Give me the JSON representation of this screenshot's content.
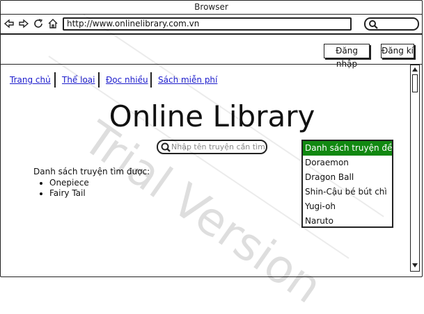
{
  "window": {
    "title": "Browser"
  },
  "browser": {
    "url": "http://www.onlinelibrary.com.vn",
    "search_placeholder": ""
  },
  "header": {
    "login_label": "Đăng nhập",
    "register_label": "Đăng kí"
  },
  "nav": {
    "items": [
      {
        "label": "Trang chủ"
      },
      {
        "label": "Thể loại"
      },
      {
        "label": "Đọc nhiều"
      },
      {
        "label": "Sách miễn phí"
      }
    ]
  },
  "main": {
    "title": "Online Library",
    "search_placeholder": "Nhập tên truyện cần tìm",
    "results_heading": "Danh sách truyện tìm được:",
    "results": [
      "Onepiece",
      "Fairy Tail"
    ]
  },
  "suggestions": {
    "heading": "Danh sách truyện đề cử",
    "items": [
      "Doraemon",
      "Dragon Ball",
      "Shin-Cậu bé bút chì",
      "Yugi-oh",
      "Naruto"
    ]
  },
  "watermark": "Trial Version",
  "colors": {
    "link": "#1b1bcc",
    "suggestion_highlight": "#118811"
  }
}
